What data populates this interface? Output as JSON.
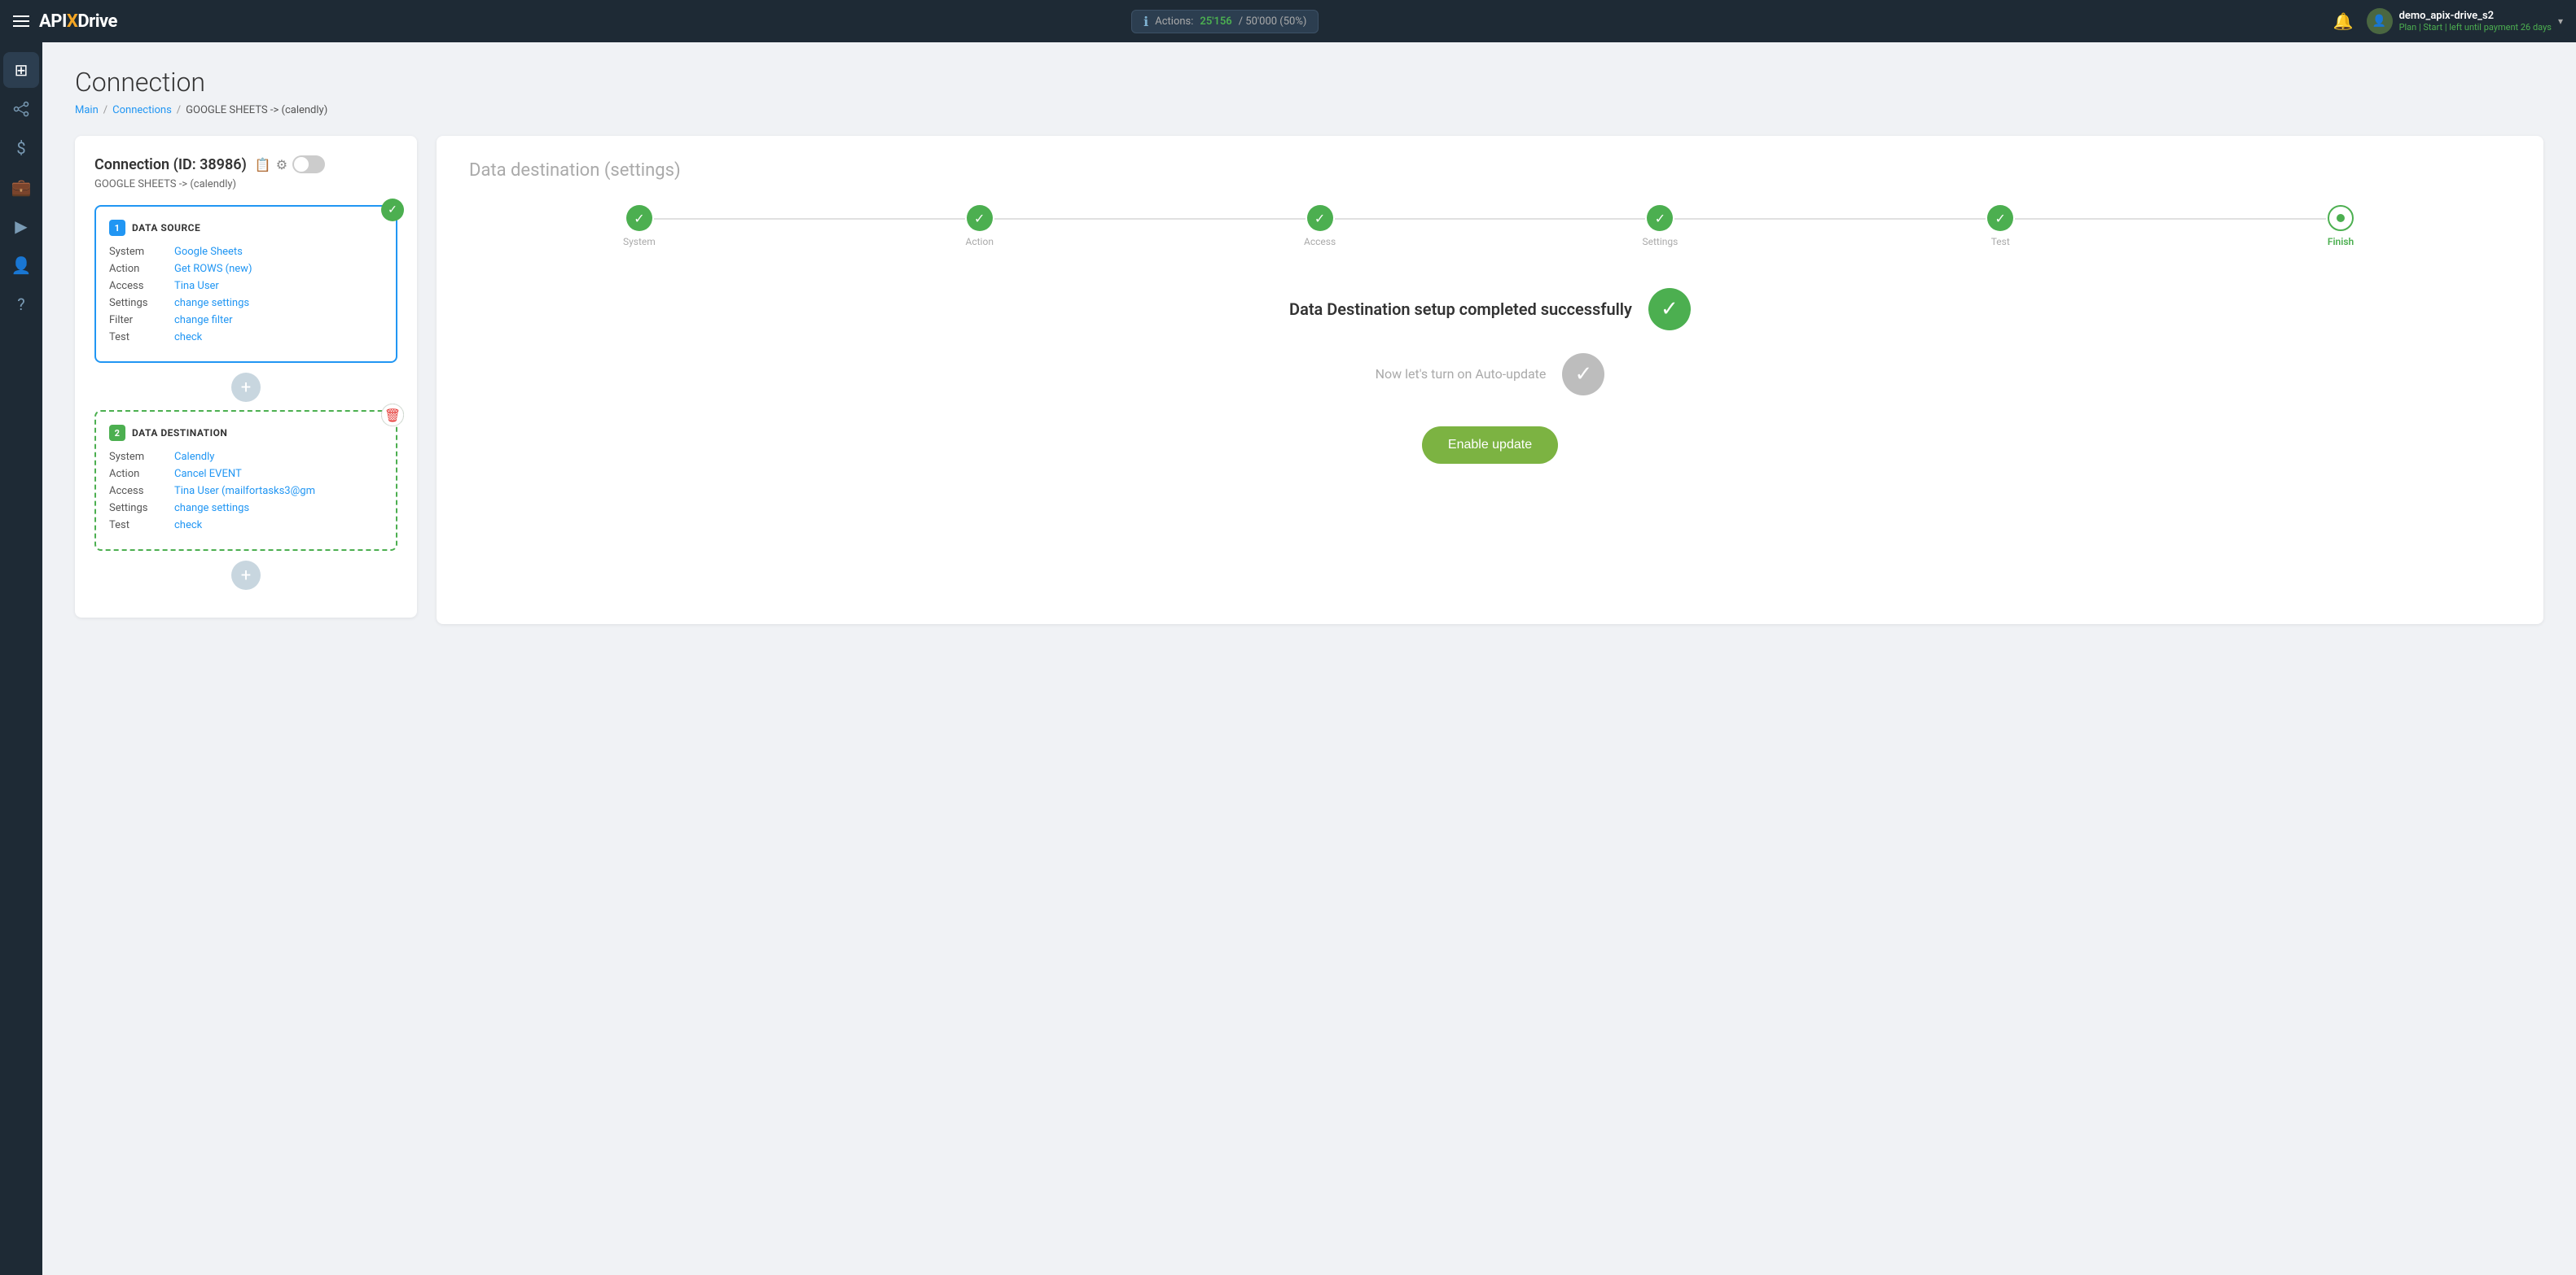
{
  "navbar": {
    "hamburger_label": "Menu",
    "logo": "APIXDrive",
    "actions_label": "Actions:",
    "actions_count": "25'156",
    "actions_total": "/ 50'000 (50%)",
    "bell_label": "Notifications",
    "user_name": "demo_apix-drive_s2",
    "user_plan": "Plan | Start | left until payment",
    "user_days": "26 days",
    "chevron": "▾"
  },
  "sidebar": {
    "items": [
      {
        "icon": "⊞",
        "name": "dashboard-icon",
        "label": "Dashboard"
      },
      {
        "icon": "⬡",
        "name": "connections-icon",
        "label": "Connections"
      },
      {
        "icon": "$",
        "name": "billing-icon",
        "label": "Billing"
      },
      {
        "icon": "💼",
        "name": "tasks-icon",
        "label": "Tasks"
      },
      {
        "icon": "▶",
        "name": "play-icon",
        "label": "Automate"
      },
      {
        "icon": "👤",
        "name": "profile-icon",
        "label": "Profile"
      },
      {
        "icon": "?",
        "name": "help-icon",
        "label": "Help"
      }
    ]
  },
  "page": {
    "title": "Connection",
    "breadcrumb": {
      "main": "Main",
      "connections": "Connections",
      "current": "GOOGLE SHEETS -> (calendly)"
    }
  },
  "left_panel": {
    "connection_id_text": "Connection (ID: 38986)",
    "subtitle": "GOOGLE SHEETS -> (calendly)",
    "data_source": {
      "block_num": "1",
      "block_title": "DATA SOURCE",
      "rows": [
        {
          "label": "System",
          "value": "Google Sheets"
        },
        {
          "label": "Action",
          "value": "Get ROWS (new)"
        },
        {
          "label": "Access",
          "value": "Tina User"
        },
        {
          "label": "Settings",
          "value": "change settings"
        },
        {
          "label": "Filter",
          "value": "change filter"
        },
        {
          "label": "Test",
          "value": "check"
        }
      ]
    },
    "data_destination": {
      "block_num": "2",
      "block_title": "DATA DESTINATION",
      "rows": [
        {
          "label": "System",
          "value": "Calendly"
        },
        {
          "label": "Action",
          "value": "Cancel EVENT"
        },
        {
          "label": "Access",
          "value": "Tina User (mailfortasks3@gm"
        },
        {
          "label": "Settings",
          "value": "change settings"
        },
        {
          "label": "Test",
          "value": "check"
        }
      ]
    },
    "add_button_label": "+"
  },
  "right_panel": {
    "title": "Data destination",
    "title_sub": "(settings)",
    "steps": [
      {
        "label": "System",
        "status": "done"
      },
      {
        "label": "Action",
        "status": "done"
      },
      {
        "label": "Access",
        "status": "done"
      },
      {
        "label": "Settings",
        "status": "done"
      },
      {
        "label": "Test",
        "status": "done"
      },
      {
        "label": "Finish",
        "status": "active"
      }
    ],
    "success_title": "Data Destination setup completed successfully",
    "auto_update_text": "Now let's turn on Auto-update",
    "enable_button": "Enable update"
  }
}
